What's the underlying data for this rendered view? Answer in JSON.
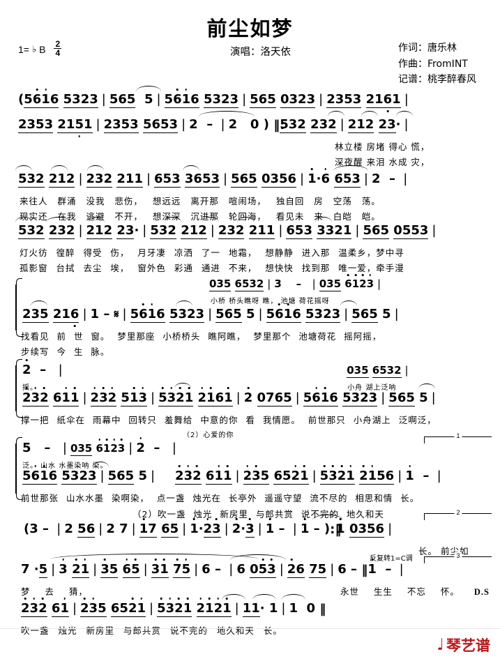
{
  "header": {
    "title": "前尘如梦",
    "key_label": "1=",
    "key_accidental": "♭",
    "key_name": "B",
    "meter_num": "2",
    "meter_den": "4",
    "singer": "演唱：洛天依",
    "credits": [
      "作词：唐乐林",
      "作曲：FromINT",
      "记谱：桃李醉春风"
    ]
  },
  "logo": {
    "mark": "♩",
    "text": "琴艺谱",
    "color": "#b5191b"
  },
  "score": {
    "lines": [
      {
        "id": "intro-a",
        "notes": "( 5 6 1̇ 6  5 3 2 3 | 5 6 5  5 | 5 6 1̇ 6  5 3 2 3 | 5 6 5  0 3 2 3 | 2 3 5 3  2 1 6 1 |",
        "lyrics": "",
        "annotation": ""
      },
      {
        "id": "intro-b",
        "notes": "2 3 5 3  2 1 5 1 | 2 3 5 3  5 6 5 3 | 2  -  | 2  0 ) ‖: 5 3 2  2 3 2 | 2 1 2  2 3 · |",
        "lyrics_1": "林立楼 房堵 得心 慌，",
        "lyrics_2": "深夜醒 来泪 水成 灾，"
      },
      {
        "id": "verse-1",
        "notes": "5 3 2  2 1 2 | 2 3 2  2 1 1 | 6 5 3  3 6 5 3 | 5 6 5  0 3 5 6 | 1̇ · 6  6 5 3 | 2  -  |",
        "lyrics_1": "来往人 群涌 没我 悲伤， 想远远 离开那 喧闹场， 独自回 房 空荡 荡。",
        "lyrics_2": "现实还 在我 逃避 不开， 想深深 沉进那 轮回海， 看见未 来 白皑 皑。"
      },
      {
        "id": "verse-2",
        "notes": "5 3 2  2 3 2 | 2 1 2  2 3 · | 5 3 2  2 1 2 | 2 3 2  2 1 1 | 6 5 3  3 3 2 1 | 5 6 5  0 5 5 3 |",
        "lyrics_1": "灯火彷 徨醉 得受 伤， 月牙凄 凉洒 了一 地霜， 想静静 进入那 温柔乡，梦中寻",
        "lyrics_2": "孤影窗 台拭 去尘 埃， 窗外色 彩通 通进 不来， 想快快 找到那 唯一爱，牵手漫"
      },
      {
        "id": "harmony-1",
        "notes": "0 3 5  6 5 3 2 | 3  -  | 0 3 5  6 1̇ 2̇ 3̇ |",
        "lyrics": "小桥 桥头瞧呀 瞧， 池塘 荷花摇呀"
      },
      {
        "id": "chorus-1",
        "notes": "2 3 5  2 1 6 | 1  - 𝄋 | 5 6 1̇ 6  5 3 2 3 | 5 6 5  5 | 5 6 1̇ 6  5 3 2 3 | 5 6 5  5 |",
        "lyrics_1": "找看见 前 世 窗。 梦里那座 小桥桥头 瞧阿瞧， 梦里那个 池塘荷花 摇阿摇，",
        "lyrics_2": "步续写 今 生 脉。"
      },
      {
        "id": "harmony-2",
        "notes": "2̇  -  |  0 3 5  6 5 3 2 |",
        "lyrics": "摇。 小舟 湖上泛呐"
      },
      {
        "id": "chorus-2",
        "notes": "2̇ 3̇ 2̇  6 1̇ 1̇ | 2̇ 3̇ 2̇  5 1̇ 3̇ | 5̇ 3̇ 2̇ 1̇  2̇ 1̇ 6 1̇ | 2̇  0 7 6 5 | 5 6 1̇ 6  5 3 2 3 | 5 6 5  5 |",
        "lyrics_1": "撑一把 纸伞在 雨幕中 回转只 羞舞给 中意的你 看 我情愿。 前世那只 小舟湖上 泛啊泛，",
        "lyrics_2": "（2）心爱的你"
      },
      {
        "id": "harmony-3",
        "notes": "5  -  | 0 3 5  6 1̇ 2̇ 3̇ | 2̇  -  |",
        "lyrics": "泛。 山水 水墨染呐 染。"
      },
      {
        "id": "chorus-3",
        "notes": "5 6 1̇ 6  5 3 2 3 | 5 6 5  5 | 2̇ 3̇ 2̇  6 1̇ 1̇ | 2̇ 3̇ 5  6 5 2̇ 1̇ | 5̇ 3̇ 2̇ 1̇  2̇ 1̇ 5 6 | 1̇  -  |",
        "lyrics_1": "前世那张 山水水墨 染啊染， 点一盏 烛光在 长亭外 遥遥守望 流不尽的 相思和情 长。",
        "lyrics_2": "（2）吹一盏 烛光 新房里 与郎共赏 说不完的 地久和天",
        "volta": "1"
      },
      {
        "id": "interlude",
        "notes": "( 3  - | 2  5 6 | 2  7 | 1̇ 7  6 5 | 1̇ · 2̇ 3̇ | 2̇ · 3̇ | 1̇  - | 1̇  - ) :‖ 1̇  0 3 5 6 |",
        "lyrics": "长。 前尘如",
        "volta": "2"
      },
      {
        "id": "bridge",
        "notes": "7 · 5 | 3̇  2̇ 1̇ | 3̇ 5  6̇ 5̇ | 3̇ 1̇  7̇ 5̇ | 6  - | 6  0 5̇ 3̇ | 2̇ 6  7 5 | 6  - ‖ 1̇  -  |",
        "lyrics": "梦 去 猜， 永世 生生 不忘 怀。 D.S 长。",
        "annotation": "反复转1=C调",
        "volta": "3"
      },
      {
        "id": "final",
        "notes": "2̇ 3̇ 2̇  6 1̇ | 2̇ 3̇ 5  6 5 2̇ 1̇ | 5̇ 3̇ 2̇ 1̇  2̇ 1̇ 2̇ 1̇ | 1̇ 1̇ ·  1̇ | 1̇  0 ‖",
        "lyrics": "吹一盏 烛光 新房里 与郎共赏 说不完的 地久和天 长。"
      }
    ]
  },
  "measures": {
    "m_intro1": [
      "5",
      "6",
      "1̇",
      "6"
    ],
    "m_intro2": [
      "5",
      "3",
      "2",
      "3"
    ],
    "m_intro3": [
      "5",
      "6",
      "5"
    ],
    "m_intro4": [
      "5"
    ]
  }
}
